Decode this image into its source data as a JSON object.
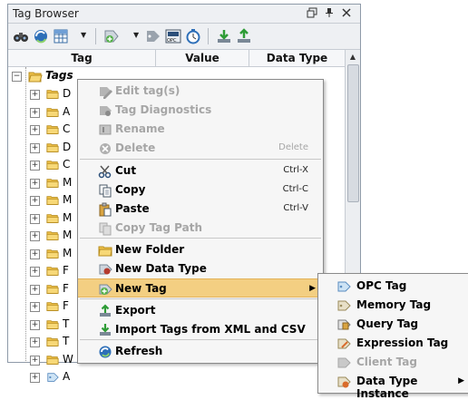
{
  "panel": {
    "title": "Tag Browser",
    "window_buttons": [
      "restore-icon",
      "pin-icon",
      "close-icon"
    ],
    "toolbar_icons": [
      "binoculars-icon",
      "refresh-globe-icon",
      "grid-table-icon",
      "add-tag-icon",
      "tag-icon",
      "opc-icon",
      "timer-icon",
      "import-icon",
      "export-icon"
    ]
  },
  "columns": [
    "Tag",
    "Value",
    "Data Type"
  ],
  "tree": {
    "root": "Tags",
    "rows": [
      "D",
      "A",
      "C",
      "D",
      "C",
      "M",
      "M",
      "M",
      "M",
      "M",
      "F",
      "F",
      "F",
      "T",
      "T",
      "W",
      "A"
    ]
  },
  "context_menu": {
    "items": [
      {
        "label": "Edit tag(s)",
        "shortcut": "",
        "enabled": false,
        "icon": "edit-tag-icon"
      },
      {
        "label": "Tag Diagnostics",
        "shortcut": "",
        "enabled": false,
        "icon": "diagnostics-icon"
      },
      {
        "label": "Rename",
        "shortcut": "",
        "enabled": false,
        "icon": "rename-icon"
      },
      {
        "label": "Delete",
        "shortcut": "Delete",
        "enabled": false,
        "icon": "delete-icon"
      },
      {
        "label": "Cut",
        "shortcut": "Ctrl-X",
        "enabled": true,
        "icon": "scissors-icon"
      },
      {
        "label": "Copy",
        "shortcut": "Ctrl-C",
        "enabled": true,
        "icon": "copy-icon"
      },
      {
        "label": "Paste",
        "shortcut": "Ctrl-V",
        "enabled": true,
        "icon": "paste-icon"
      },
      {
        "label": "Copy Tag Path",
        "shortcut": "",
        "enabled": false,
        "icon": "copy-path-icon"
      },
      {
        "label": "New Folder",
        "shortcut": "",
        "enabled": true,
        "icon": "new-folder-icon"
      },
      {
        "label": "New Data Type",
        "shortcut": "",
        "enabled": true,
        "icon": "data-type-icon"
      },
      {
        "label": "New Tag",
        "shortcut": "",
        "enabled": true,
        "icon": "new-tag-icon",
        "highlighted": true
      },
      {
        "label": "Export",
        "shortcut": "",
        "enabled": true,
        "icon": "export-icon"
      },
      {
        "label": "Import Tags from XML and CSV",
        "shortcut": "",
        "enabled": true,
        "icon": "import-icon"
      },
      {
        "label": "Refresh",
        "shortcut": "",
        "enabled": true,
        "icon": "refresh-icon"
      }
    ]
  },
  "submenu": {
    "items": [
      {
        "label": "OPC Tag",
        "enabled": true,
        "icon": "opc-tag-icon"
      },
      {
        "label": "Memory Tag",
        "enabled": true,
        "icon": "memory-tag-icon"
      },
      {
        "label": "Query Tag",
        "enabled": true,
        "icon": "query-tag-icon"
      },
      {
        "label": "Expression Tag",
        "enabled": true,
        "icon": "expression-tag-icon"
      },
      {
        "label": "Client Tag",
        "enabled": false,
        "icon": "client-tag-icon"
      },
      {
        "label": "Data Type Instance",
        "enabled": true,
        "icon": "data-type-instance-icon"
      }
    ]
  },
  "colors": {
    "highlight": "#f3cf82",
    "folder": "#f0c24a",
    "disabled": "#a6a6a6"
  }
}
